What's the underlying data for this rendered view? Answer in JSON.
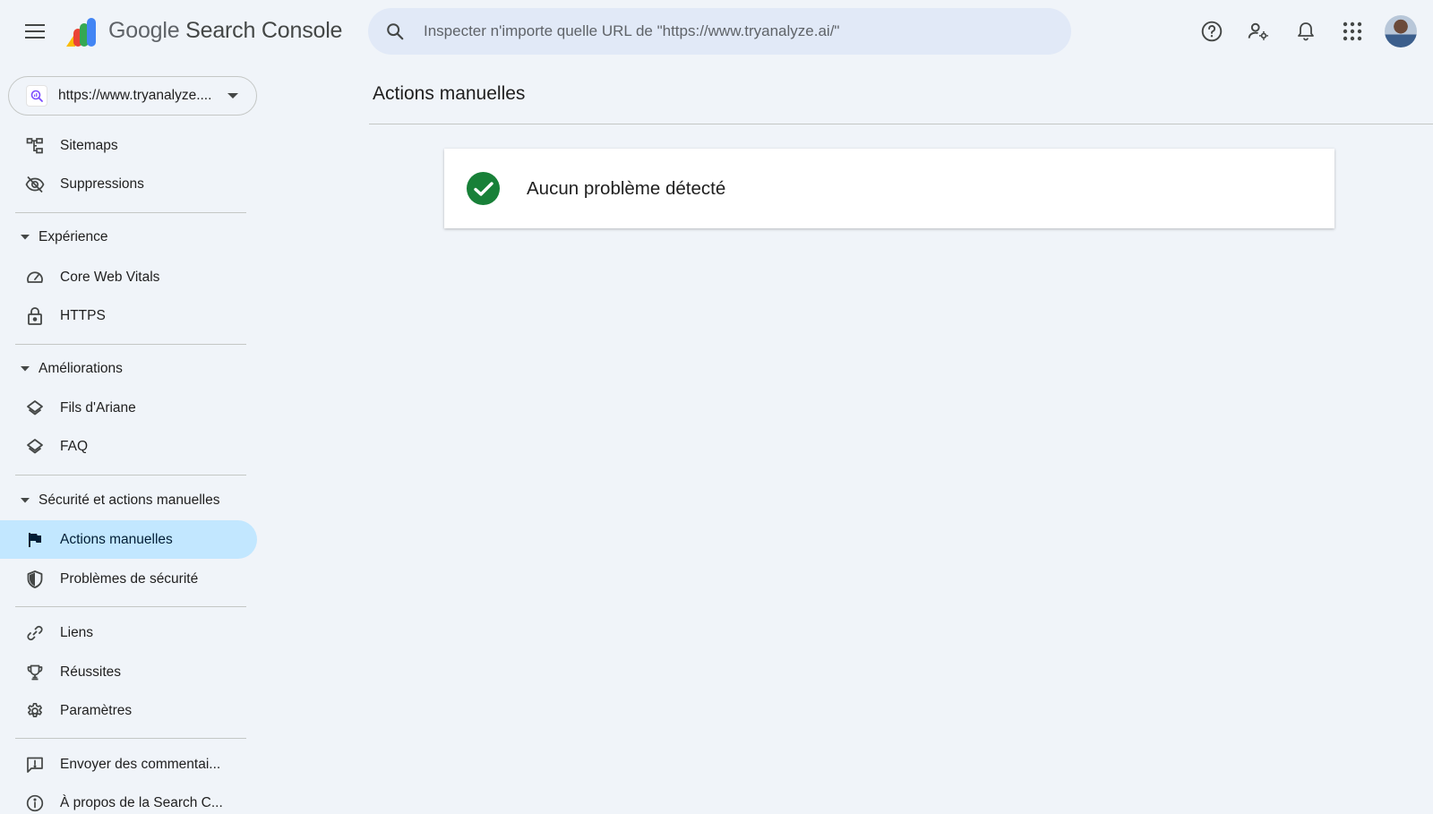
{
  "header": {
    "product_prefix": "Google",
    "product_suffix": "Search Console",
    "search_placeholder": "Inspecter n'importe quelle URL de \"https://www.tryanalyze.ai/\"",
    "icons": [
      "menu-icon",
      "search-icon",
      "help-icon",
      "manage-users-icon",
      "notifications-icon",
      "apps-icon",
      "avatar"
    ]
  },
  "property": {
    "label": "https://www.tryanalyze...."
  },
  "sidebar": {
    "top_items": [
      {
        "label": "Sitemaps",
        "icon": "sitemap-icon"
      },
      {
        "label": "Suppressions",
        "icon": "visibility-off-icon"
      }
    ],
    "sections": [
      {
        "title": "Expérience",
        "items": [
          {
            "label": "Core Web Vitals",
            "icon": "speed-icon"
          },
          {
            "label": "HTTPS",
            "icon": "lock-icon"
          }
        ]
      },
      {
        "title": "Améliorations",
        "items": [
          {
            "label": "Fils d'Ariane",
            "icon": "layers-icon"
          },
          {
            "label": "FAQ",
            "icon": "layers-icon"
          }
        ]
      },
      {
        "title": "Sécurité et actions manuelles",
        "items": [
          {
            "label": "Actions manuelles",
            "icon": "flag-icon",
            "active": true
          },
          {
            "label": "Problèmes de sécurité",
            "icon": "shield-icon"
          }
        ]
      }
    ],
    "bottom_items": [
      {
        "label": "Liens",
        "icon": "link-icon"
      },
      {
        "label": "Réussites",
        "icon": "trophy-icon"
      },
      {
        "label": "Paramètres",
        "icon": "gear-icon"
      }
    ],
    "footer_items": [
      {
        "label": "Envoyer des commentai...",
        "icon": "feedback-icon"
      },
      {
        "label": "À propos de la Search C...",
        "icon": "info-icon"
      }
    ]
  },
  "main": {
    "title": "Actions manuelles",
    "status_text": "Aucun problème détecté"
  },
  "colors": {
    "background": "#f0f4f9",
    "active_nav": "#c2e7ff",
    "search_bg": "#e1e9f7",
    "success": "#188038"
  }
}
